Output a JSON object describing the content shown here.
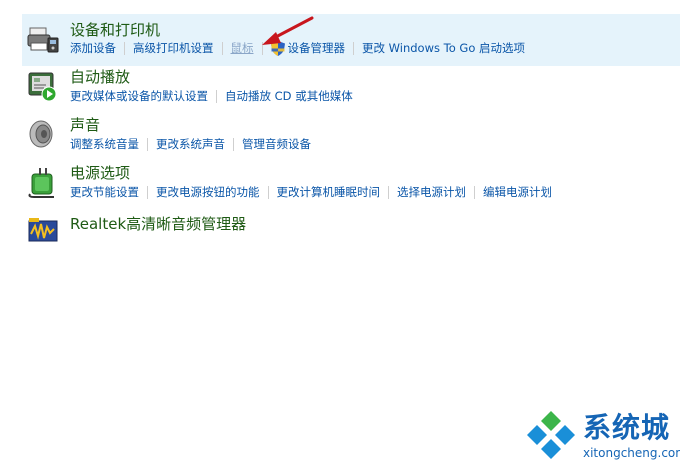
{
  "categories": {
    "devices": {
      "title": "设备和打印机",
      "links": [
        "添加设备",
        "高级打印机设置",
        "鼠标",
        "设备管理器",
        "更改 Windows To Go 启动选项"
      ]
    },
    "autoplay": {
      "title": "自动播放",
      "links": [
        "更改媒体或设备的默认设置",
        "自动播放 CD 或其他媒体"
      ]
    },
    "sound": {
      "title": "声音",
      "links": [
        "调整系统音量",
        "更改系统声音",
        "管理音频设备"
      ]
    },
    "power": {
      "title": "电源选项",
      "links": [
        "更改节能设置",
        "更改电源按钮的功能",
        "更改计算机睡眠时间",
        "选择电源计划",
        "编辑电源计划"
      ]
    },
    "realtek": {
      "title": "Realtek高清晰音频管理器"
    }
  },
  "watermark": {
    "title": "系统城",
    "subtitle": "xitongcheng.com"
  },
  "colors": {
    "title_green": "#1e5a14",
    "link_blue": "#0b56a8",
    "highlight_bg": "#e5f3fb",
    "arrow_red": "#c8161d",
    "logo_blue": "#1565b5"
  }
}
